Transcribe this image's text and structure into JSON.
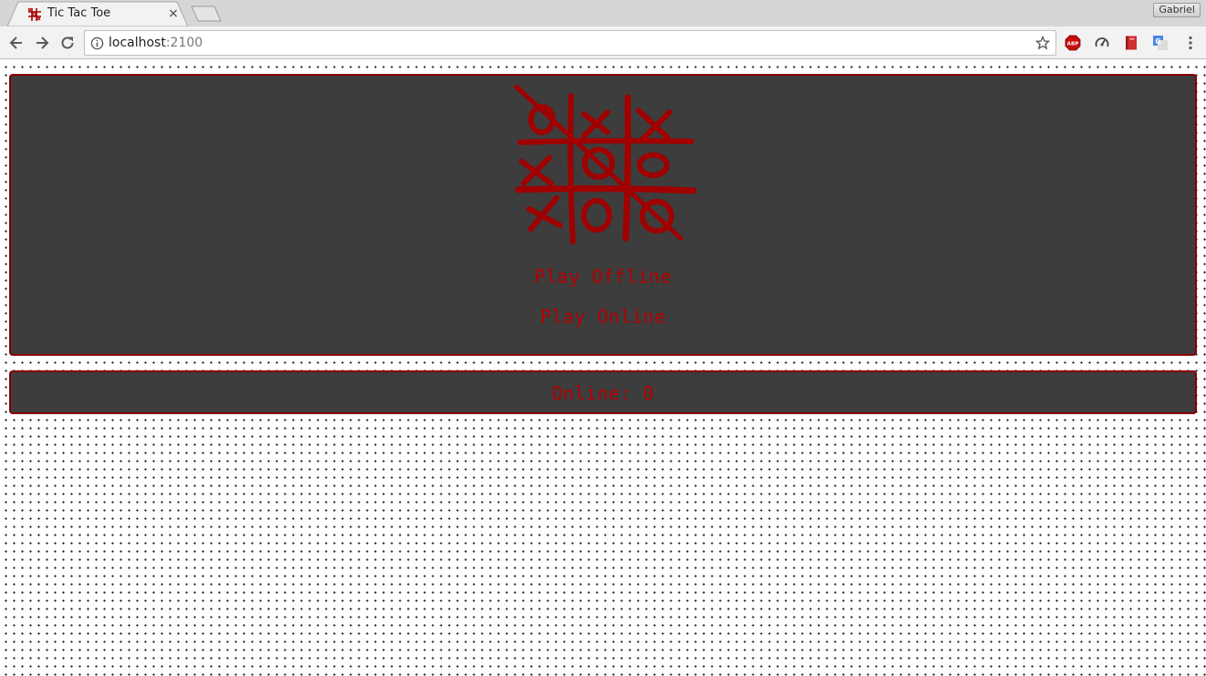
{
  "browser": {
    "tab_title": "Tic Tac Toe",
    "tab_close_glyph": "×",
    "url_host": "localhost",
    "url_port": ":2100",
    "profile_name": "Gabriel",
    "extensions": [
      "adblock-plus-icon",
      "speedometer-icon",
      "red-book-icon",
      "google-translate-icon"
    ]
  },
  "page": {
    "menu": {
      "play_offline": "Play Offline",
      "play_online": "Play Online"
    },
    "status": {
      "online_count_text": "Online: 0"
    }
  },
  "colors": {
    "accent_red": "#b30000",
    "panel_bg": "#3d3d3d",
    "panel_border": "#8b0000"
  }
}
